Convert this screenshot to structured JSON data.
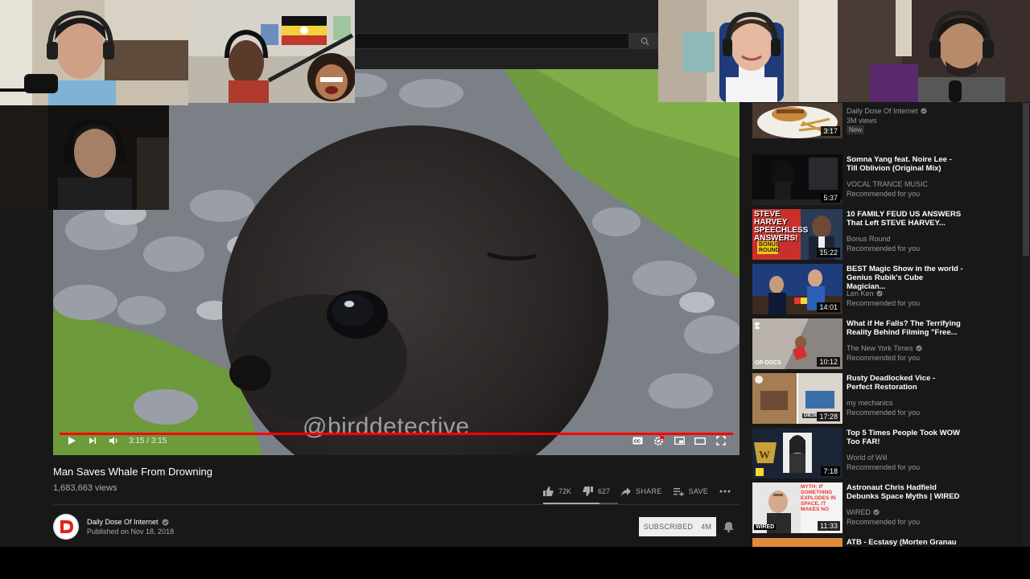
{
  "player": {
    "time": "3:15 / 3:15",
    "watermark": "@birddetective",
    "progress_fraction": 1.0
  },
  "video": {
    "title": "Man Saves Whale From Drowning",
    "views": "1,683,663 views",
    "likes": "72K",
    "dislikes": "627",
    "share_label": "SHARE",
    "save_label": "SAVE"
  },
  "channel": {
    "name": "Daily Dose Of Internet",
    "published": "Published on Nov 18, 2018",
    "subscribe_label": "SUBSCRIBED",
    "subscriber_count": "4M"
  },
  "recommendations": [
    {
      "title": "",
      "channel": "Daily Dose Of Internet",
      "meta": "3M views",
      "duration": "3:17",
      "badge": "New",
      "verified": true
    },
    {
      "title": "Somna Yang feat. Noire Lee - Till Oblivion (Original Mix)",
      "channel": "VOCAL TRANCE MUSIC",
      "meta": "Recommended for you",
      "duration": "5:37",
      "verified": false
    },
    {
      "title": "10 FAMILY FEUD US ANSWERS That Left STEVE HARVEY...",
      "channel": "Bonus Round",
      "meta": "Recommended for you",
      "duration": "15:22",
      "verified": false
    },
    {
      "title": "BEST Magic Show in the world - Genius Rubik's Cube Magician...",
      "channel": "Len Ken",
      "meta": "Recommended for you",
      "duration": "14:01",
      "verified": true
    },
    {
      "title": "What if He Falls? The Terrifying Reality Behind Filming \"Free...",
      "channel": "The New York Times",
      "meta": "Recommended for you",
      "duration": "10:12",
      "verified": true
    },
    {
      "title": "Rusty Deadlocked Vice - Perfect Restoration",
      "channel": "my mechanics",
      "meta": "Recommended for you",
      "duration": "17:28",
      "verified": false
    },
    {
      "title": "Top 5 Times People Took WOW Too FAR!",
      "channel": "World of Will",
      "meta": "Recommended for you",
      "duration": "7:18",
      "verified": false
    },
    {
      "title": "Astronaut Chris Hadfield Debunks Space Myths | WIRED",
      "channel": "WIRED",
      "meta": "Recommended for you",
      "duration": "11:33",
      "verified": true
    },
    {
      "title": "ATB - Ecstasy (Morten Granau",
      "channel": "",
      "meta": "",
      "duration": "",
      "verified": false
    }
  ],
  "thumb_text": {
    "steve": "STEVE HARVEY SPEECHLESS ANSWERS!",
    "bonus": "BONUS ROUND",
    "opdocs": "OP-DOCS",
    "diesel": "DIESEL",
    "myth": "MYTH: IF SOMETHING EXPLODES IN SPACE, IT MAKES NO",
    "wired": "WIRED"
  },
  "colors": {
    "accent": "#ff0000",
    "background": "#181818",
    "masthead": "#212121",
    "text_secondary": "#aaaaaa"
  }
}
